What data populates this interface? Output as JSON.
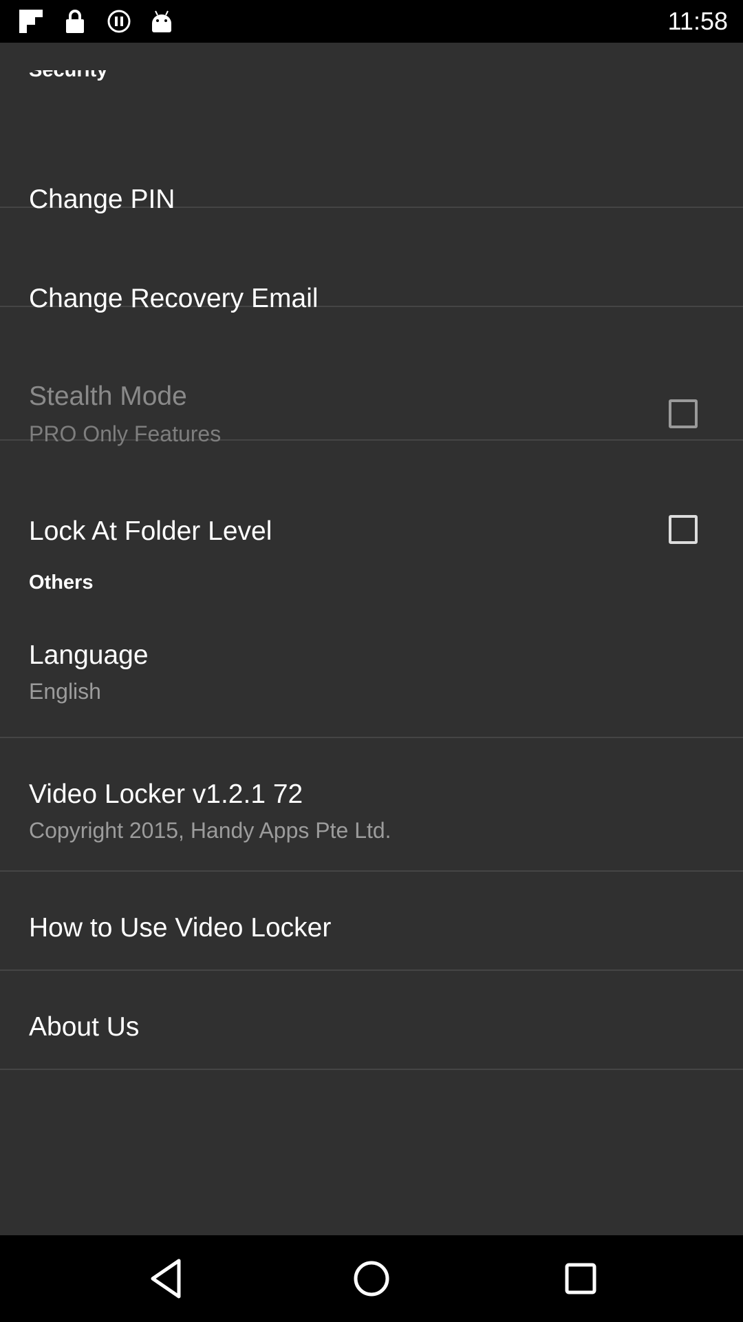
{
  "status_bar": {
    "time": "11:58",
    "icons": [
      "flipboard-icon",
      "lock-icon",
      "record-icon",
      "android-icon"
    ]
  },
  "settings": {
    "clipped_header": "Security",
    "items": [
      {
        "title": "Change PIN"
      },
      {
        "title": "Change Recovery Email"
      },
      {
        "title": "Stealth Mode",
        "summary": "PRO Only Features",
        "checked": false,
        "enabled": false
      },
      {
        "title": "Lock At Folder Level",
        "checked": false,
        "enabled": true
      }
    ],
    "others_header": "Others",
    "others_items": [
      {
        "title": "Language",
        "summary": "English"
      },
      {
        "title": "Video Locker v1.2.1 72",
        "summary": "Copyright 2015, Handy Apps Pte Ltd."
      },
      {
        "title": "How to Use Video Locker"
      },
      {
        "title": "About Us"
      }
    ]
  },
  "nav_bar": {
    "icons": [
      "back-icon",
      "home-icon",
      "recents-icon"
    ]
  }
}
